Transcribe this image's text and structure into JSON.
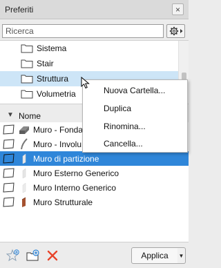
{
  "window": {
    "title": "Preferiti",
    "close_glyph": "×"
  },
  "search": {
    "placeholder": "Ricerca",
    "value": ""
  },
  "folders": [
    {
      "label": "Sistema",
      "selected": false
    },
    {
      "label": "Stair",
      "selected": false
    },
    {
      "label": "Struttura",
      "selected": true
    },
    {
      "label": "Volumetria",
      "selected": false
    }
  ],
  "list": {
    "header": "Nome",
    "sort_glyph": "▼",
    "items": [
      {
        "label": "Muro - Fonda",
        "icon": "wall-block-icon",
        "selected": false
      },
      {
        "label": "Muro - Involu",
        "icon": "wall-curve-icon",
        "selected": false
      },
      {
        "label": "Muro di partizione",
        "icon": "wall-thin-icon",
        "selected": true
      },
      {
        "label": "Muro Esterno Generico",
        "icon": "wall-light-icon",
        "selected": false
      },
      {
        "label": "Muro Interno Generico",
        "icon": "wall-light-icon",
        "selected": false
      },
      {
        "label": "Muro Strutturale",
        "icon": "wall-brick-icon",
        "selected": false
      }
    ]
  },
  "context_menu": {
    "items": [
      "Nuova Cartella...",
      "Duplica",
      "Rinomina...",
      "Cancella..."
    ]
  },
  "footer": {
    "apply_label": "Applica",
    "apply_arrow": "▼"
  },
  "colors": {
    "selection": "#2f86d9",
    "folder_selection": "#cde5f7",
    "delete": "#e8442a"
  }
}
